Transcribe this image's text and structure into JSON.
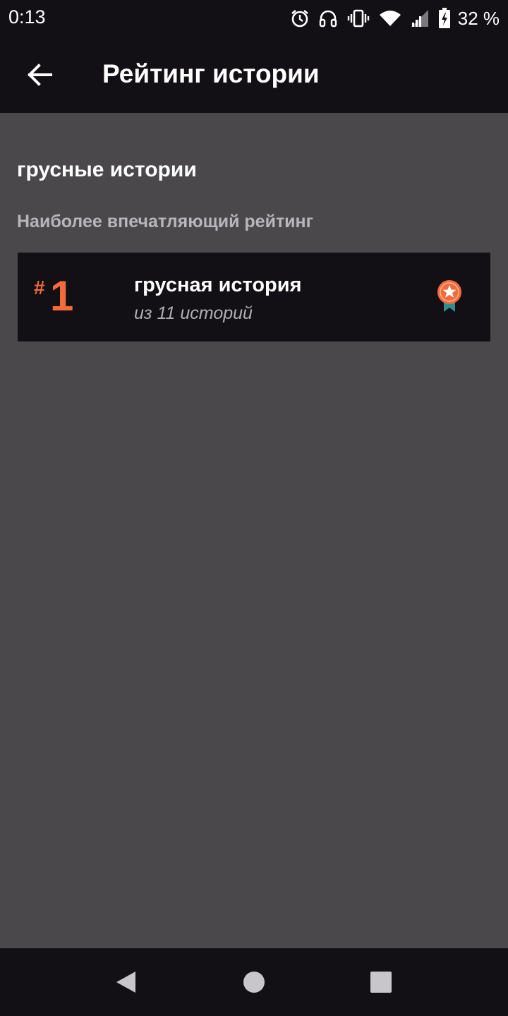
{
  "status_bar": {
    "time": "0:13",
    "battery_percent": "32 %",
    "icons": [
      "alarm-icon",
      "headphones-icon",
      "vibrate-icon",
      "wifi-icon",
      "signal-icon",
      "battery-charging-icon"
    ]
  },
  "app_bar": {
    "back_icon": "arrow-left-icon",
    "title": "Рейтинг истории"
  },
  "section": {
    "title": "грусные истории",
    "subtitle": "Наиболее впечатляющий рейтинг"
  },
  "rank_item": {
    "hash": "#",
    "rank": "1",
    "story_name": "грусная история",
    "count_text": "из 11 историй",
    "badge_icon": "award-ribbon-icon"
  },
  "nav_bar": {
    "buttons": [
      "back-triangle-icon",
      "home-circle-icon",
      "recents-square-icon"
    ]
  },
  "colors": {
    "bars": "#121014",
    "background": "#4a484b",
    "accent": "#f26b3a",
    "ribbon": "#2f8f8f"
  }
}
